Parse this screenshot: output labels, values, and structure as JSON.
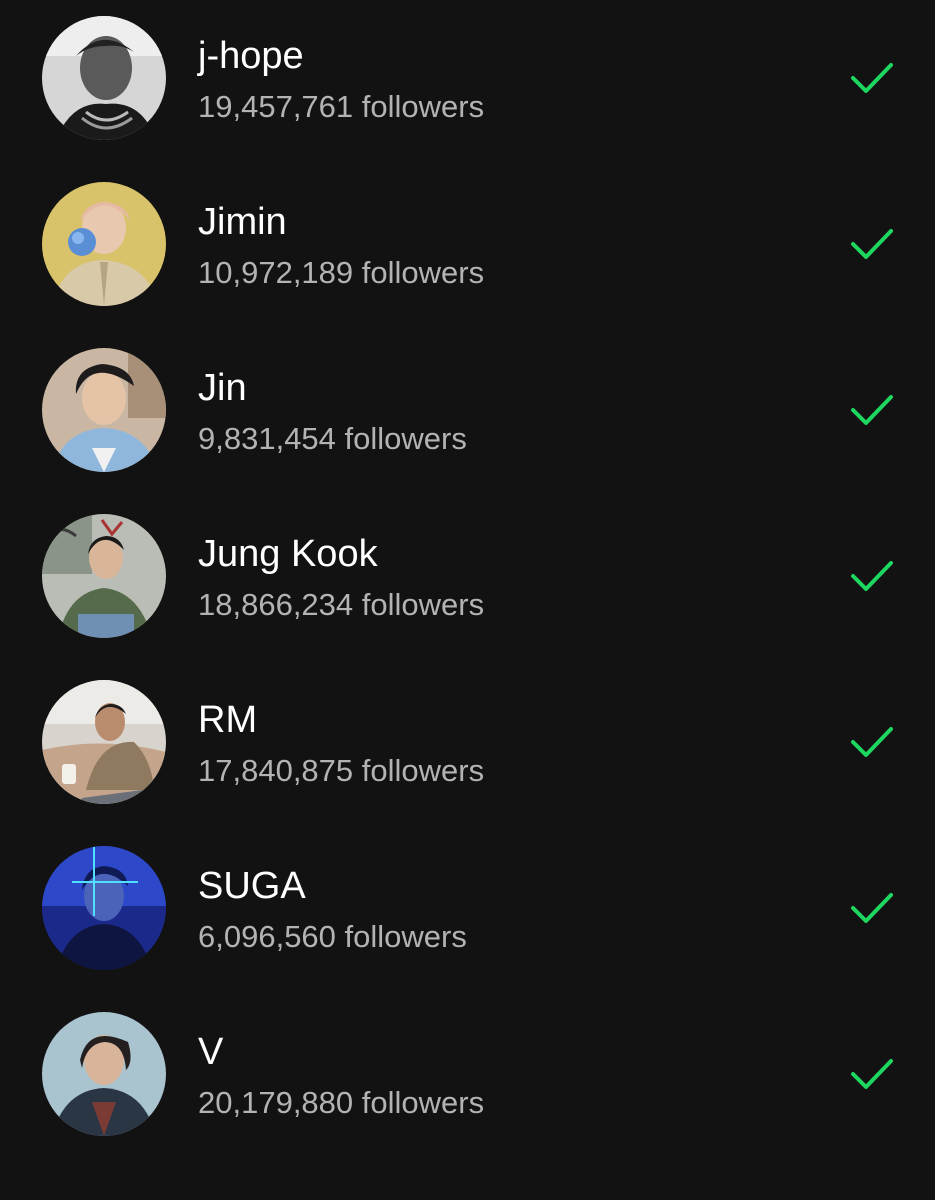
{
  "colors": {
    "background": "#121212",
    "name_text": "#ffffff",
    "followers_text": "#b3b3b3",
    "check": "#1ed760"
  },
  "artists": [
    {
      "name": "j-hope",
      "followers": "19,457,761 followers",
      "following": true,
      "avatar_icon": "avatar-photo"
    },
    {
      "name": "Jimin",
      "followers": "10,972,189 followers",
      "following": true,
      "avatar_icon": "avatar-photo"
    },
    {
      "name": "Jin",
      "followers": "9,831,454 followers",
      "following": true,
      "avatar_icon": "avatar-photo"
    },
    {
      "name": "Jung Kook",
      "followers": "18,866,234 followers",
      "following": true,
      "avatar_icon": "avatar-photo"
    },
    {
      "name": "RM",
      "followers": "17,840,875 followers",
      "following": true,
      "avatar_icon": "avatar-photo"
    },
    {
      "name": "SUGA",
      "followers": "6,096,560 followers",
      "following": true,
      "avatar_icon": "avatar-photo"
    },
    {
      "name": "V",
      "followers": "20,179,880 followers",
      "following": true,
      "avatar_icon": "avatar-photo"
    }
  ]
}
